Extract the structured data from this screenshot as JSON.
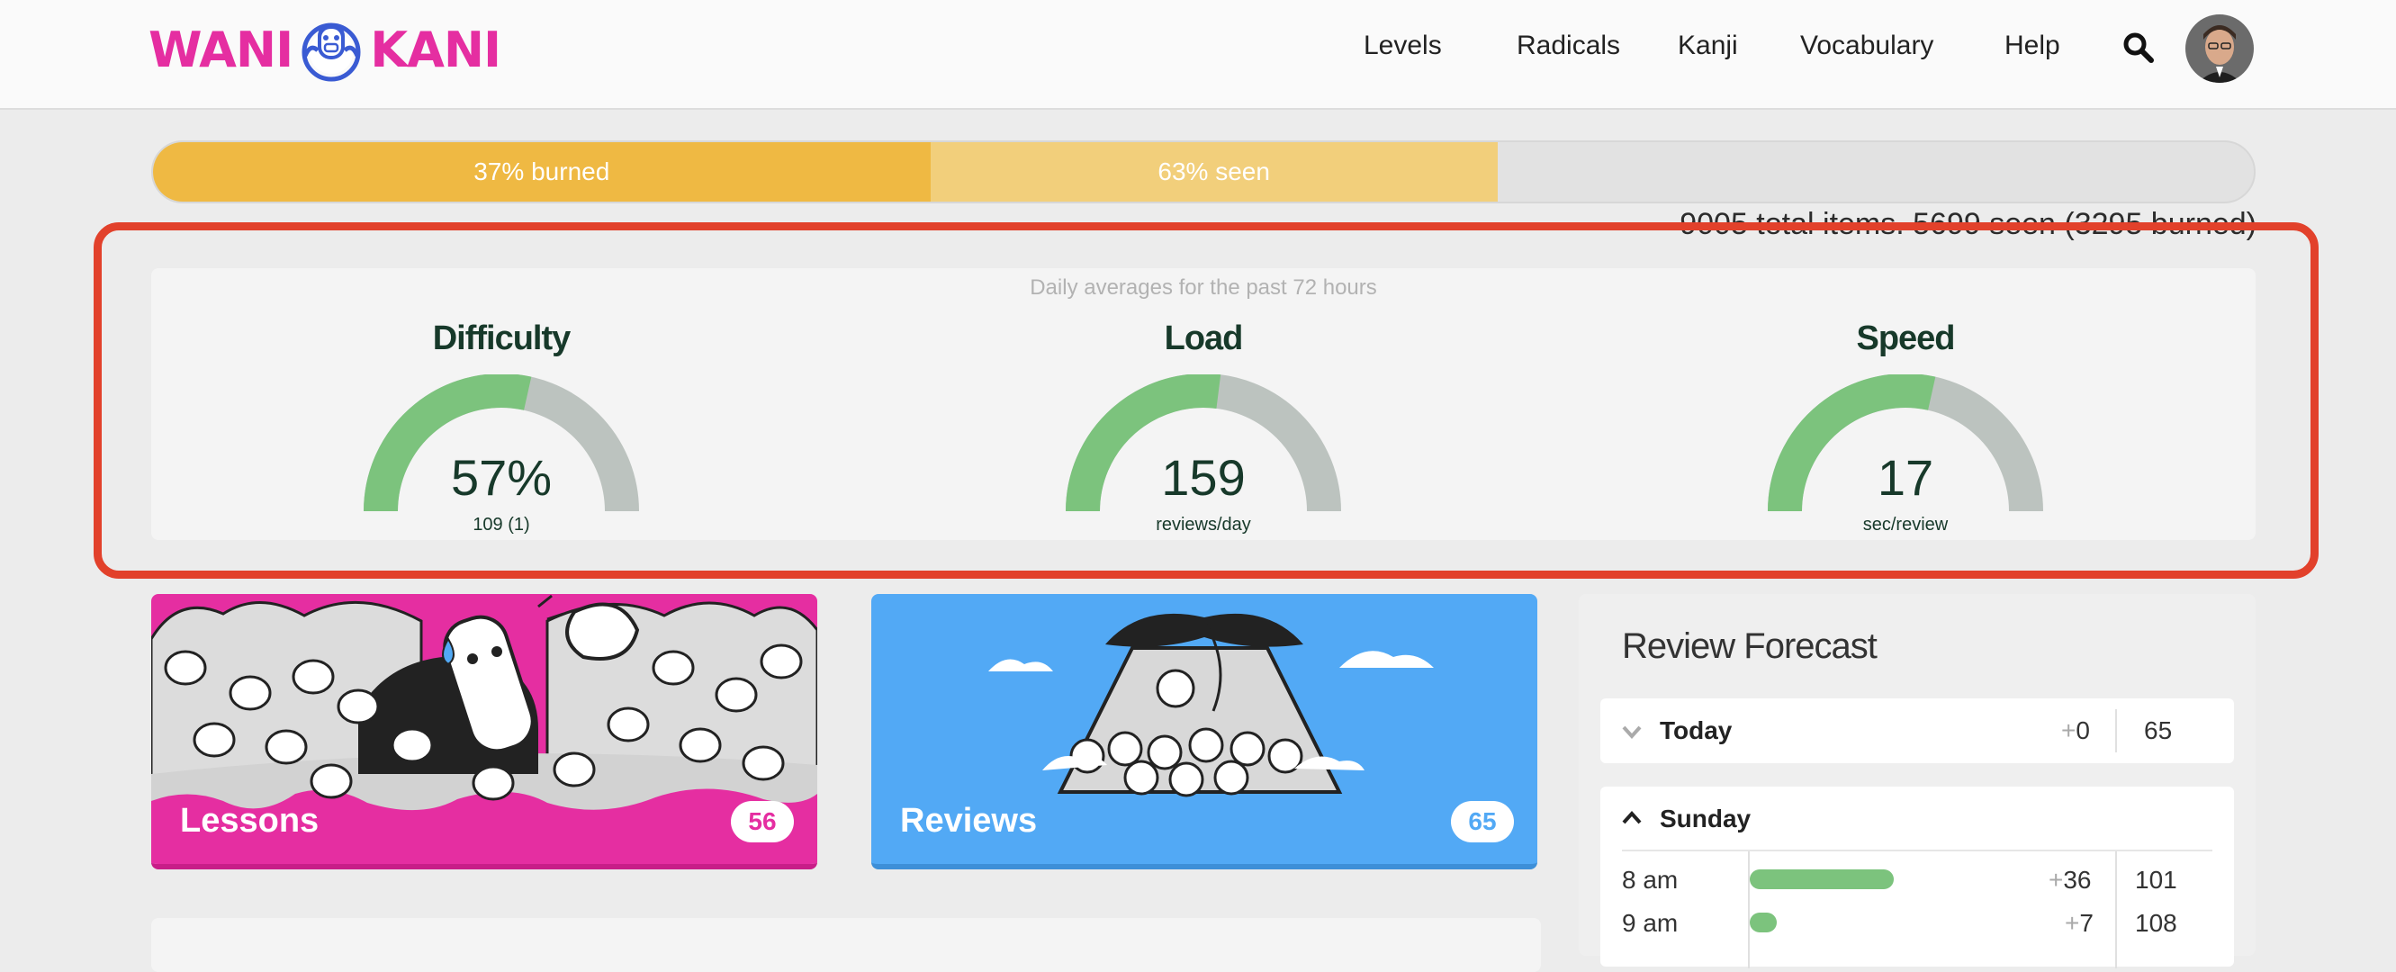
{
  "logo": {
    "left": "WANI",
    "right": "KANI"
  },
  "nav": {
    "items": [
      "Levels",
      "Radicals",
      "Kanji",
      "Vocabulary",
      "Help"
    ],
    "search_icon": "search-icon",
    "avatar_icon": "user-avatar"
  },
  "progress": {
    "burned_label": "37% burned",
    "seen_label": "63% seen",
    "burned_fraction": 0.37,
    "seen_fraction": 0.27,
    "totals": "9005 total items. 5699 seen (3295 burned)"
  },
  "stats": {
    "caption": "Daily averages for the past 72 hours",
    "gauges": [
      {
        "title": "Difficulty",
        "value": "57%",
        "sub": "109 (1)",
        "fill": 0.57
      },
      {
        "title": "Load",
        "value": "159",
        "sub": "reviews/day",
        "fill": 0.54
      },
      {
        "title": "Speed",
        "value": "17",
        "sub": "sec/review",
        "fill": 0.57
      }
    ]
  },
  "lessons": {
    "label": "Lessons",
    "count": "56"
  },
  "reviews": {
    "label": "Reviews",
    "count": "65"
  },
  "forecast": {
    "title": "Review Forecast",
    "today": {
      "day": "Today",
      "plus": "0",
      "total": "65"
    },
    "sunday": {
      "day": "Sunday",
      "hours": [
        {
          "hour": "8 am",
          "plus": "36",
          "total": "101",
          "fraction": 1.0
        },
        {
          "hour": "9 am",
          "plus": "7",
          "total": "108",
          "fraction": 0.19
        }
      ]
    }
  },
  "colors": {
    "brand_pink": "#e52ea1",
    "review_blue": "#52a9f5",
    "burned": "#efb943",
    "seen": "#f2cf7b",
    "gauge_green": "#7cc37d",
    "gauge_grey": "#bcc3bf",
    "highlight": "#e2412b"
  }
}
